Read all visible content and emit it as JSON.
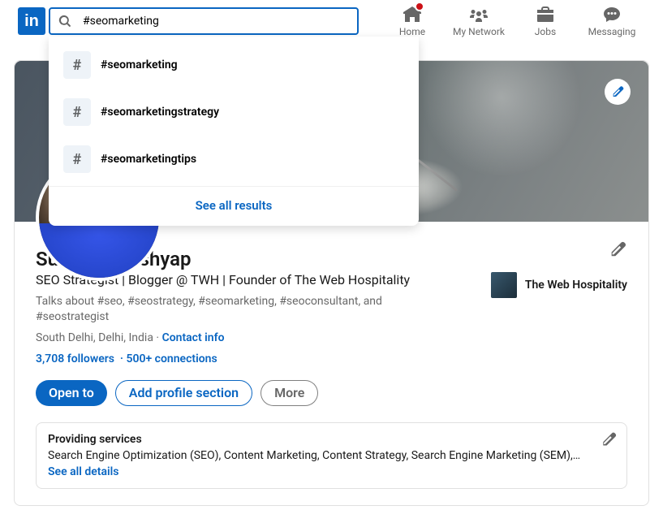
{
  "search": {
    "value": "#seomarketing"
  },
  "nav": {
    "home": "Home",
    "network": "My Network",
    "jobs": "Jobs",
    "messaging": "Messaging"
  },
  "suggestions": {
    "items": [
      "#seomarketing",
      "#seomarketingstrategy",
      "#seomarketingtips"
    ],
    "see_all": "See all results"
  },
  "profile": {
    "name": "Subhash Kashyap",
    "headline": "SEO Strategist | Blogger @ TWH | Founder of The Web Hospitality",
    "talks": "Talks about #seo, #seostrategy, #seomarketing, #seoconsultant, and #seostrategist",
    "location": "South Delhi, Delhi, India",
    "contact": "Contact info",
    "followers": "3,708 followers",
    "connections": "500+ connections",
    "company": "The Web Hospitality"
  },
  "buttons": {
    "open_to": "Open to",
    "add_section": "Add profile section",
    "more": "More"
  },
  "services": {
    "title": "Providing services",
    "text": "Search Engine Optimization (SEO), Content Marketing, Content Strategy, Search Engine Marketing (SEM), Onli…",
    "link": "See all details"
  }
}
